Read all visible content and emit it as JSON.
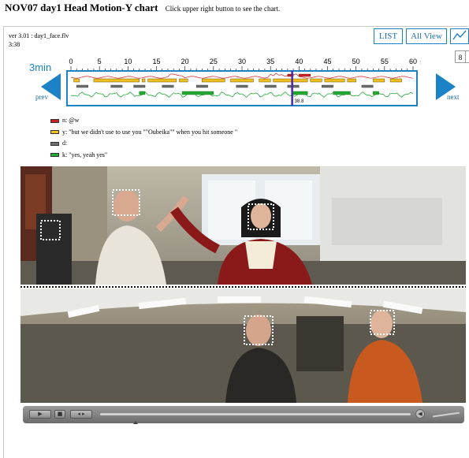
{
  "header": {
    "title": "NOV07 day1 Head Motion-Y chart",
    "hint": "Click upper right button to see the chart."
  },
  "info": {
    "version_line": "ver 3.01 : day1_face.flv",
    "time": "3:38",
    "duration": "3min"
  },
  "buttons": {
    "list": "LIST",
    "all_view": "All View",
    "chart_icon": "chart-line-icon",
    "tab_number": "8"
  },
  "nav": {
    "prev": "prev",
    "next": "next"
  },
  "timeline": {
    "ticks": [
      "0",
      "5",
      "10",
      "15",
      "20",
      "25",
      "30",
      "35",
      "40",
      "45",
      "50",
      "55",
      "60"
    ],
    "unit": "sec",
    "cursor_value": 38.8,
    "cursor_label": "38.8",
    "colors": {
      "n": "#cc2222",
      "y": "#f0c020",
      "d": "#6e6e6e",
      "k": "#22aa33",
      "frame": "#1c82c7",
      "cursor": "#4a2aa0"
    }
  },
  "legend": [
    {
      "key": "n",
      "text": "n: @w",
      "color": "#cc2222"
    },
    {
      "key": "y",
      "text": "y: \"but we didn't use to use you \"\"Oubeika\"\" when you hit someone \"",
      "color": "#f0c020"
    },
    {
      "key": "d",
      "text": "d:",
      "color": "#6e6e6e"
    },
    {
      "key": "k",
      "text": "k: \"yes, yeah yes\"",
      "color": "#22aa33"
    }
  ],
  "player": {
    "play_icon": "play-icon",
    "stop_icon": "stop-icon",
    "step_icon": "step-icon",
    "volume_icon": "volume-icon"
  }
}
